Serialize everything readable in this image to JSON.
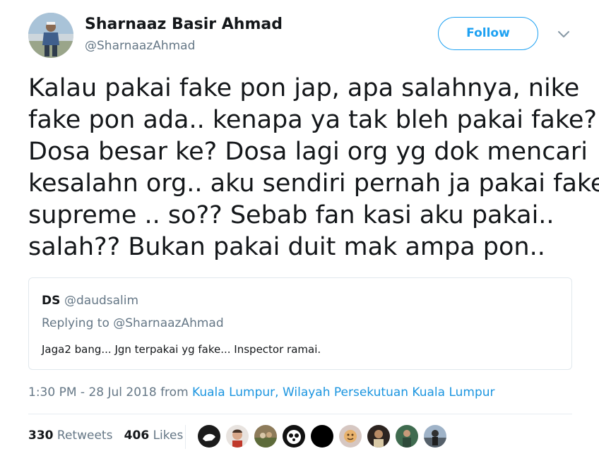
{
  "author": {
    "name": "Sharnaaz Basir Ahmad",
    "handle": "@SharnaazAhmad",
    "avatar_icon": "user-avatar-photo"
  },
  "follow_button": {
    "label": "Follow",
    "color": "#1da1f2"
  },
  "more_icon": "chevron-down-icon",
  "tweet_lines": [
    "Kalau pakai fake pon jap, apa salahnya, nike",
    "fake pon ada.. kenapa ya tak bleh pakai fake?",
    "Dosa besar ke? Dosa lagi org yg dok mencari",
    "kesalahn org.. aku sendiri pernah ja pakai fake",
    "supreme .. so?? Sebab fan kasi aku pakai..",
    "salah?? Bukan pakai duit mak ampa pon.."
  ],
  "quoted_tweet": {
    "name": "DS",
    "handle": "@daudsalim",
    "replying_to": "Replying to @SharnaazAhmad",
    "text": "Jaga2 bang... Jgn terpakai yg fake... Inspector ramai."
  },
  "meta": {
    "time": "1:30 PM - 28 Jul 2018",
    "from_label": "from",
    "location": "Kuala Lumpur, Wilayah Persekutuan Kuala Lumpur"
  },
  "stats": {
    "retweets_count": "330",
    "retweets_label": "Retweets",
    "likes_count": "406",
    "likes_label": "Likes"
  },
  "liker_avatars": [
    "liker-avatar-1",
    "liker-avatar-2",
    "liker-avatar-3",
    "liker-avatar-4",
    "liker-avatar-5",
    "liker-avatar-6",
    "liker-avatar-7",
    "liker-avatar-8",
    "liker-avatar-9"
  ],
  "colors": {
    "text": "#14171a",
    "secondary": "#657786",
    "link": "#1b95e0",
    "border": "#e1e8ed"
  }
}
